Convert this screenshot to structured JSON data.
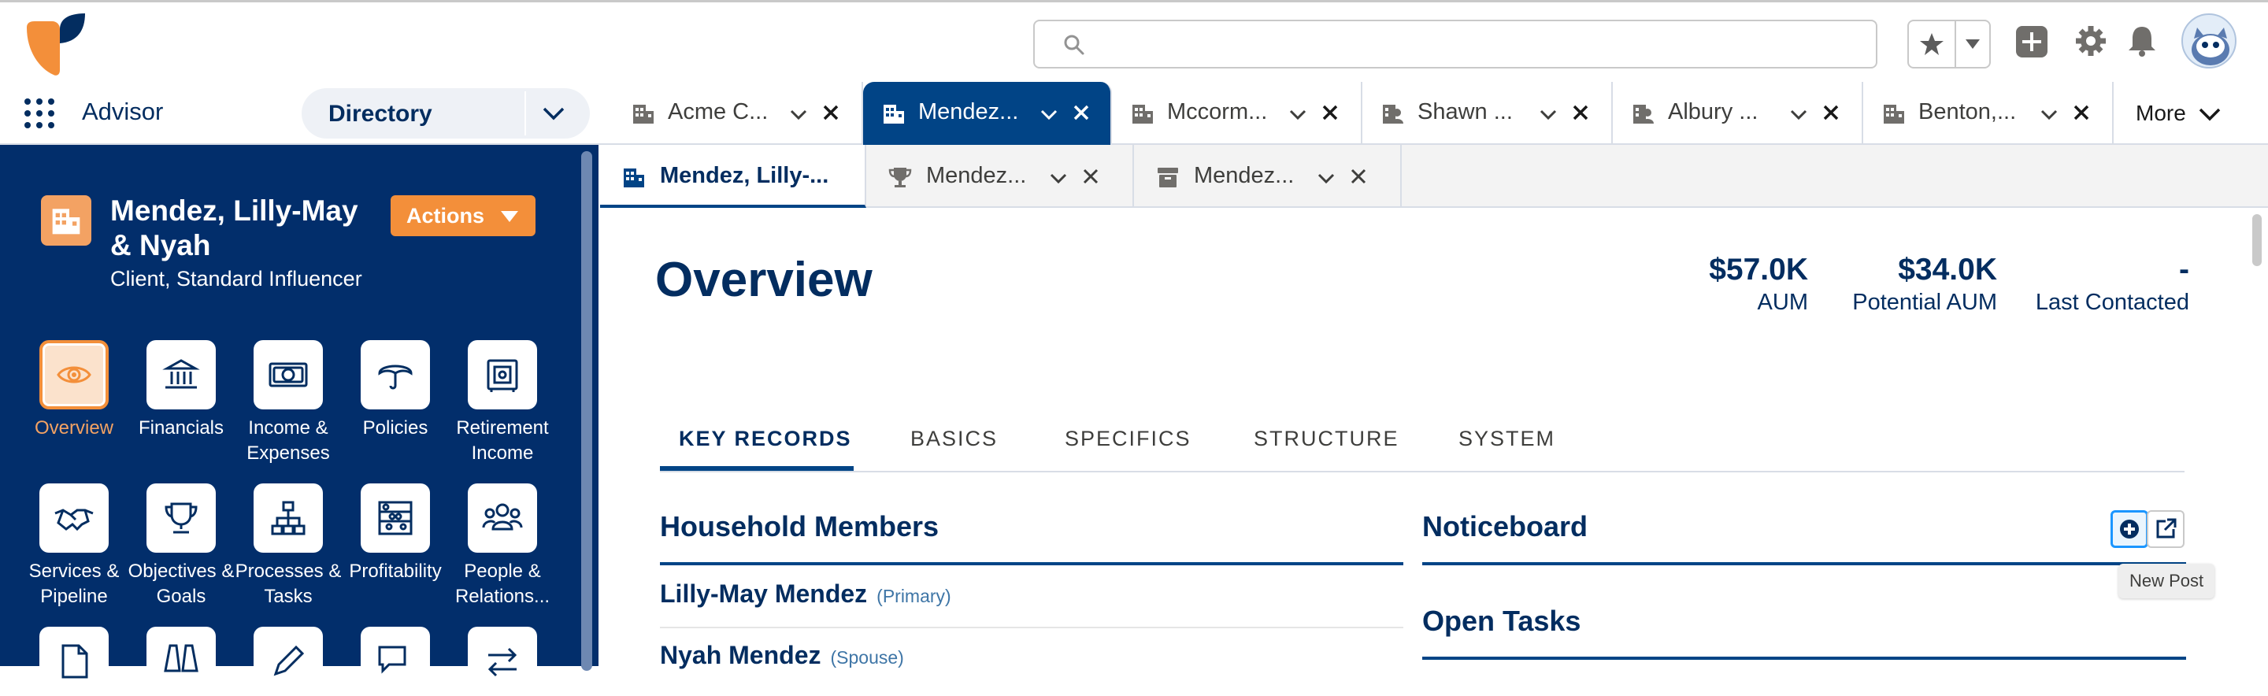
{
  "header": {
    "search": {
      "placeholder": ""
    },
    "colors": {
      "logo_orange": "#F38F3A",
      "logo_navy": "#032D60"
    }
  },
  "nav": {
    "app_name": "Advisor",
    "directory_label": "Directory",
    "tabs": [
      {
        "label": "Acme C...",
        "icon": "building-icon"
      },
      {
        "label": "Mendez...",
        "icon": "building-icon",
        "active": true
      },
      {
        "label": "Mccorm...",
        "icon": "building-icon"
      },
      {
        "label": "Shawn ...",
        "icon": "person-card-icon"
      },
      {
        "label": "Albury ...",
        "icon": "person-card-icon"
      },
      {
        "label": "Benton,...",
        "icon": "building-icon"
      }
    ],
    "more_label": "More"
  },
  "subtabs": [
    {
      "label": "Mendez, Lilly-...",
      "icon": "building-icon",
      "active": true
    },
    {
      "label": "Mendez...",
      "icon": "trophy-icon"
    },
    {
      "label": "Mendez...",
      "icon": "archive-icon"
    }
  ],
  "sidebar": {
    "record_name": "Mendez, Lilly-May & Nyah",
    "record_subtitle": "Client, Standard Influencer",
    "actions_label": "Actions",
    "tiles": [
      {
        "label": "Overview",
        "icon": "eye-icon",
        "selected": true
      },
      {
        "label": "Financials",
        "icon": "bank-icon"
      },
      {
        "label": "Income & Expenses",
        "icon": "money-icon"
      },
      {
        "label": "Policies",
        "icon": "umbrella-icon"
      },
      {
        "label": "Retirement Income",
        "icon": "safe-icon"
      },
      {
        "label": "Services & Pipeline",
        "icon": "handshake-icon"
      },
      {
        "label": "Objectives & Goals",
        "icon": "trophy-icon"
      },
      {
        "label": "Processes & Tasks",
        "icon": "hierarchy-icon"
      },
      {
        "label": "Profitability",
        "icon": "abacus-icon"
      },
      {
        "label": "People & Relations...",
        "icon": "people-icon"
      }
    ]
  },
  "overview": {
    "title": "Overview",
    "metrics": [
      {
        "value": "$57.0K",
        "label": "AUM"
      },
      {
        "value": "$34.0K",
        "label": "Potential AUM"
      },
      {
        "value": "-",
        "label": "Last Contacted"
      }
    ],
    "record_tabs": [
      "KEY RECORDS",
      "BASICS",
      "SPECIFICS",
      "STRUCTURE",
      "SYSTEM"
    ],
    "household": {
      "title": "Household Members",
      "members": [
        {
          "name": "Lilly-May Mendez",
          "role": "(Primary)"
        },
        {
          "name": "Nyah Mendez",
          "role": "(Spouse)"
        }
      ]
    },
    "noticeboard": {
      "title": "Noticeboard",
      "tooltip": "New Post"
    },
    "open_tasks": {
      "title": "Open Tasks"
    }
  }
}
